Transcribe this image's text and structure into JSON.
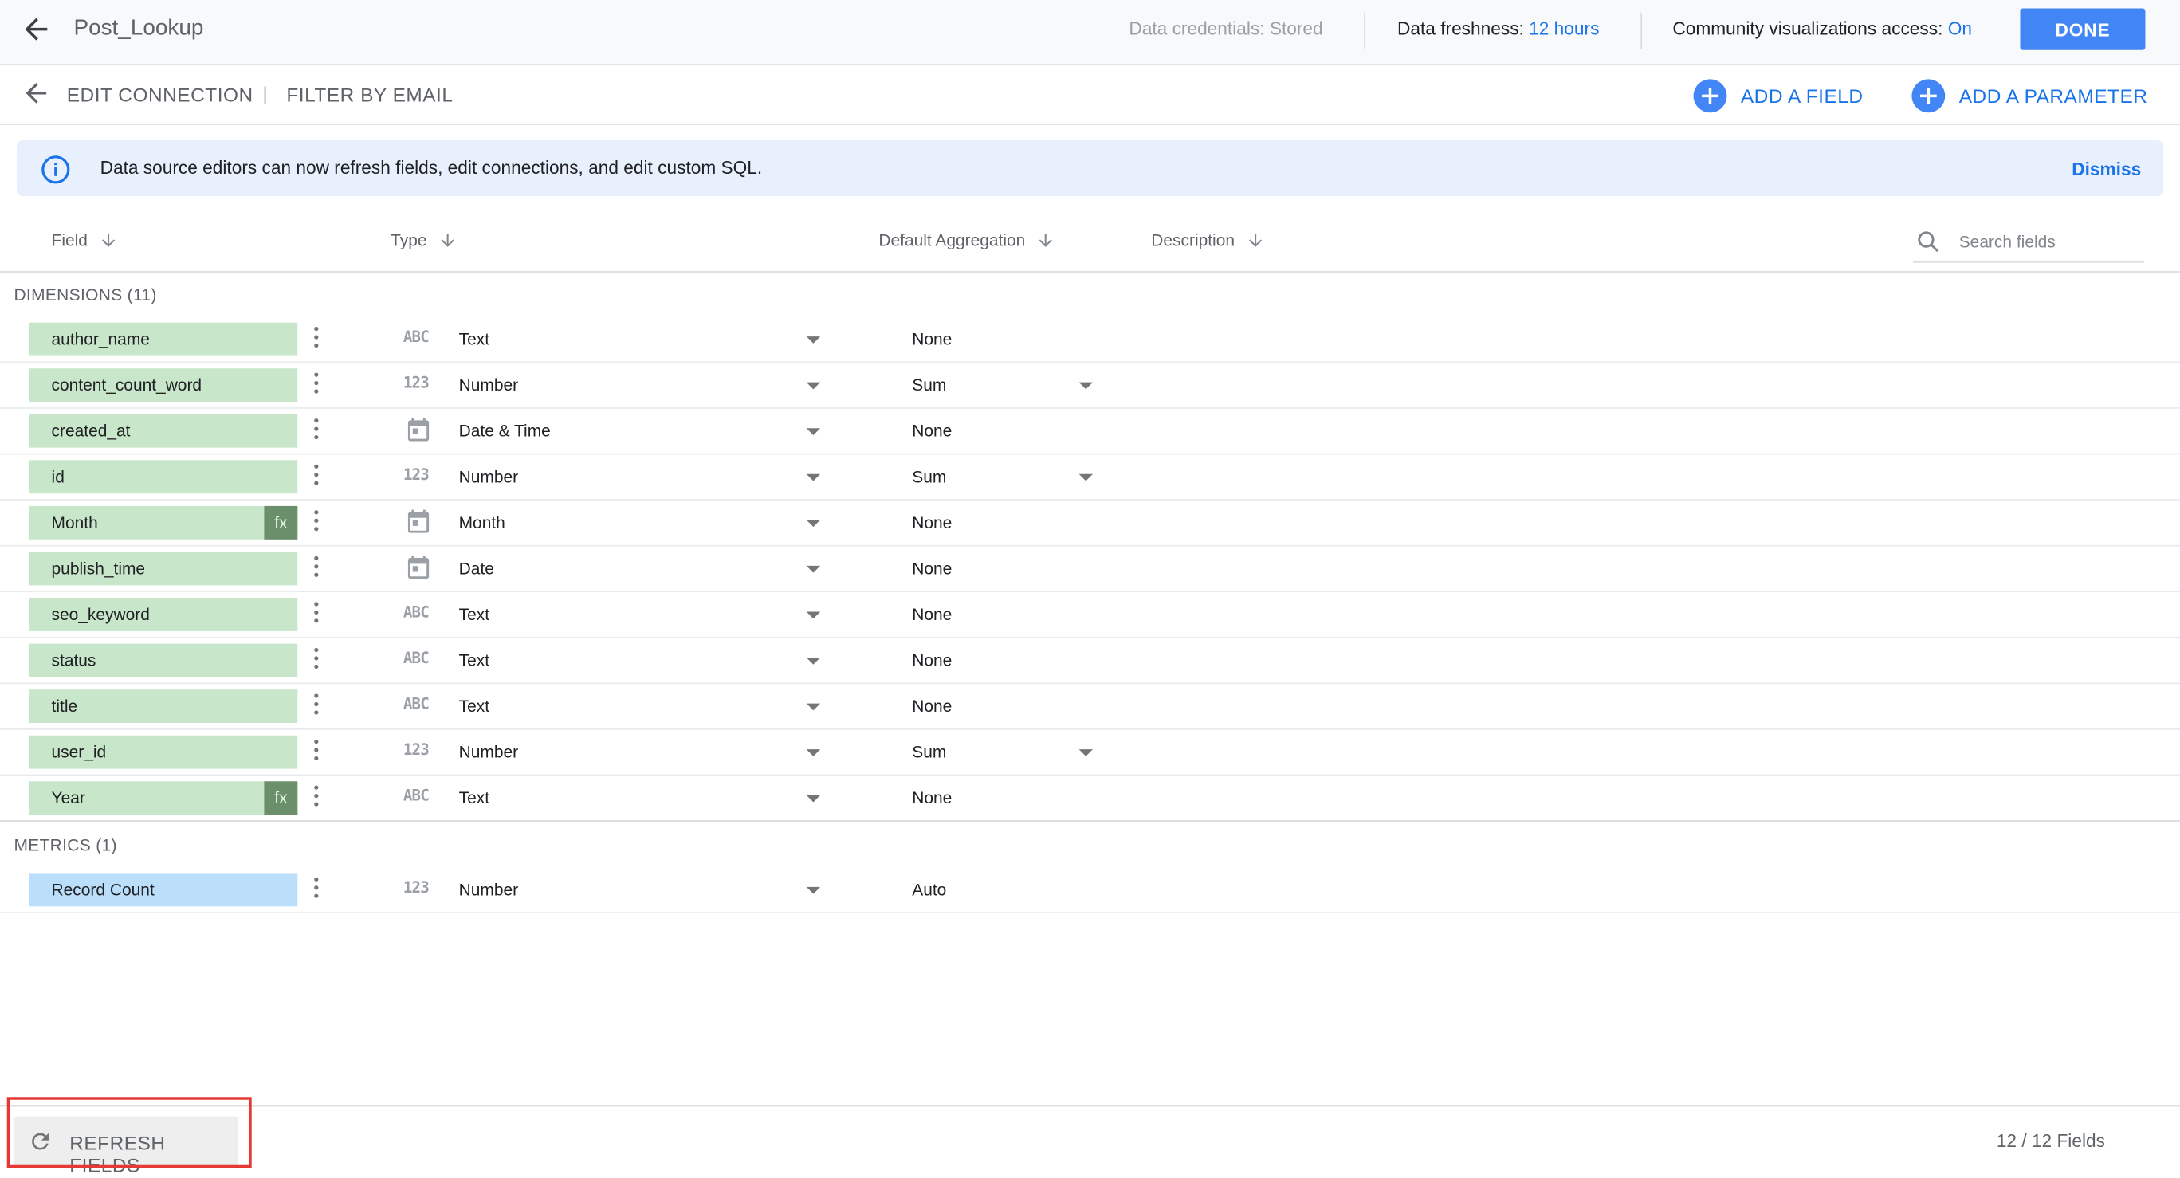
{
  "header": {
    "datasource_name": "Post_Lookup",
    "credentials_text": "Data credentials: Stored",
    "freshness_label": "Data freshness:",
    "freshness_value": "12 hours",
    "community_label": "Community visualizations access:",
    "community_value": "On",
    "done_label": "DONE"
  },
  "toolbar": {
    "edit_connection": "EDIT CONNECTION",
    "separator": "|",
    "filter_by_email": "FILTER BY EMAIL",
    "add_field": "ADD A FIELD",
    "add_parameter": "ADD A PARAMETER"
  },
  "banner": {
    "text": "Data source editors can now refresh fields, edit connections, and edit custom SQL.",
    "dismiss": "Dismiss"
  },
  "columns": {
    "field": "Field",
    "type": "Type",
    "aggregation": "Default Aggregation",
    "description": "Description",
    "search_placeholder": "Search fields"
  },
  "dimensions": {
    "label": "DIMENSIONS (11)",
    "rows": [
      {
        "name": "author_name",
        "type_icon": "ABC",
        "type": "Text",
        "aggregation": "None"
      },
      {
        "name": "content_count_word",
        "type_icon": "123",
        "type": "Number",
        "aggregation": "Sum"
      },
      {
        "name": "created_at",
        "type_icon": "calendar",
        "type": "Date & Time",
        "aggregation": "None"
      },
      {
        "name": "id",
        "type_icon": "123",
        "type": "Number",
        "aggregation": "Sum"
      },
      {
        "name": "Month",
        "type_icon": "calendar",
        "type": "Month",
        "aggregation": "None",
        "calculated": "fx"
      },
      {
        "name": "publish_time",
        "type_icon": "calendar",
        "type": "Date",
        "aggregation": "None"
      },
      {
        "name": "seo_keyword",
        "type_icon": "ABC",
        "type": "Text",
        "aggregation": "None"
      },
      {
        "name": "status",
        "type_icon": "ABC",
        "type": "Text",
        "aggregation": "None"
      },
      {
        "name": "title",
        "type_icon": "ABC",
        "type": "Text",
        "aggregation": "None"
      },
      {
        "name": "user_id",
        "type_icon": "123",
        "type": "Number",
        "aggregation": "Sum"
      },
      {
        "name": "Year",
        "type_icon": "ABC",
        "type": "Text",
        "aggregation": "None",
        "calculated": "fx"
      }
    ]
  },
  "metrics": {
    "label": "METRICS (1)",
    "rows": [
      {
        "name": "Record Count",
        "type_icon": "123",
        "type": "Number",
        "aggregation": "Auto"
      }
    ]
  },
  "footer": {
    "refresh_label": "REFRESH FIELDS",
    "field_count": "12 / 12 Fields"
  },
  "colors": {
    "accent": "#4285f4",
    "link": "#1a73e8",
    "dimension_chip": "#c8e6c9",
    "metric_chip": "#bbdefb",
    "calculated_badge": "#6b8e6b",
    "banner_bg": "#e8f0fe",
    "highlight": "#e53935"
  }
}
